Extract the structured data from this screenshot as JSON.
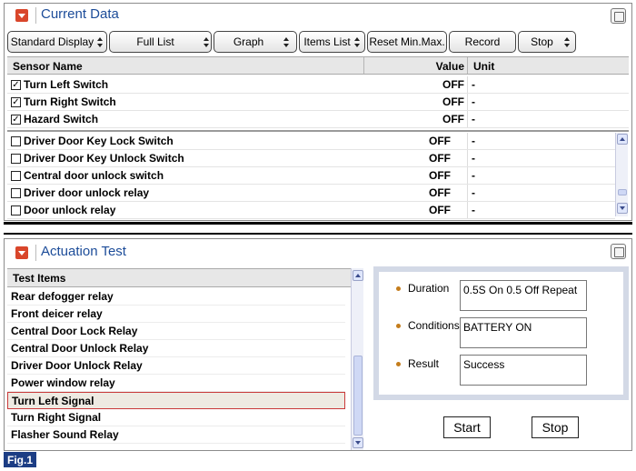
{
  "current_data": {
    "title": "Current Data",
    "toolbar": {
      "standard_display": "Standard Display",
      "full_list": "Full List",
      "graph": "Graph",
      "items_list": "Items List",
      "reset_min_max": "Reset Min.Max.",
      "record": "Record",
      "stop": "Stop"
    },
    "columns": {
      "sensor_name": "Sensor Name",
      "value": "Value",
      "unit": "Unit"
    },
    "pinned_rows": [
      {
        "checked": true,
        "name": "Turn Left Switch",
        "value": "OFF",
        "unit": "-"
      },
      {
        "checked": true,
        "name": "Turn Right Switch",
        "value": "OFF",
        "unit": "-"
      },
      {
        "checked": true,
        "name": "Hazard Switch",
        "value": "OFF",
        "unit": "-"
      }
    ],
    "rows": [
      {
        "checked": false,
        "name": "Driver Door Key Lock Switch",
        "value": "OFF",
        "unit": "-"
      },
      {
        "checked": false,
        "name": "Driver Door Key Unlock Switch",
        "value": "OFF",
        "unit": "-"
      },
      {
        "checked": false,
        "name": "Central door unlock switch",
        "value": "OFF",
        "unit": "-"
      },
      {
        "checked": false,
        "name": "Driver door unlock relay",
        "value": "OFF",
        "unit": "-"
      },
      {
        "checked": false,
        "name": "Door unlock relay",
        "value": "OFF",
        "unit": "-"
      }
    ]
  },
  "actuation_test": {
    "title": "Actuation Test",
    "list_header": "Test Items",
    "items": [
      "Rear defogger relay",
      "Front deicer relay",
      "Central Door Lock Relay",
      "Central Door Unlock Relay",
      "Driver Door Unlock Relay",
      "Power window relay",
      "Turn Left Signal",
      "Turn Right Signal",
      "Flasher Sound Relay"
    ],
    "selected_index": 6,
    "details": {
      "duration_label": "Duration",
      "duration_value": "0.5S On 0.5 Off Repeat",
      "conditions_label": "Conditions",
      "conditions_value": "BATTERY ON",
      "result_label": "Result",
      "result_value": "Success"
    },
    "start_label": "Start",
    "stop_label": "Stop"
  },
  "figure_label": "Fig.1",
  "colors": {
    "title_blue": "#1c4c99",
    "collapse_red": "#d9462b",
    "selected_border": "#c93a3a",
    "fig_label_bg": "#1c3d84"
  }
}
